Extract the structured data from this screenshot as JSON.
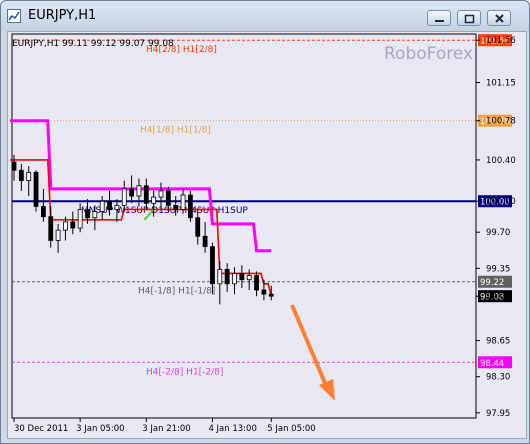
{
  "window": {
    "title": "EURJPY,H1"
  },
  "chart_header": {
    "symbol_info": "EURJPY,H1  99.11 99.12 99.07 99.08",
    "watermark": "RoboForex"
  },
  "colors": {
    "background": "#e8e8f4",
    "candles": "#000000",
    "red_line": "#ff0000",
    "magenta_line": "#ff00ff",
    "blue_line": "#000080",
    "arrow": "#ff8030"
  },
  "levels": [
    {
      "value": 101.56,
      "label": "H4[2/8] H1[2/8]",
      "line_color": "#ff4000",
      "tag_bg": "#ff4000",
      "tag_text": "101.56",
      "style": "dashed"
    },
    {
      "value": 100.78,
      "label": "H4[1/8] H1[1/8]",
      "line_color": "#e8a040",
      "tag_bg": "#f0a040",
      "tag_text": "100.78",
      "style": "dotted"
    },
    {
      "value": 100.0,
      "label": "MNSUP W1SUP D1SUP H4SUP H1SUP",
      "line_color": "#000080",
      "tag_bg": "#000080",
      "tag_text": "100.00",
      "style": "solid"
    },
    {
      "value": 99.22,
      "label": "H4[-1/8] H1[-1/8]",
      "line_color": "#606060",
      "tag_bg": "#606060",
      "tag_text": "99.22",
      "style": "dashed"
    },
    {
      "value": 98.44,
      "label": "H4[-2/8] H1[-2/8]",
      "line_color": "#e040e0",
      "tag_bg": "#ff00ff",
      "tag_text": "98.44",
      "style": "dashed"
    }
  ],
  "current_price": {
    "value": 99.08,
    "text": "99.08"
  },
  "chart_data": {
    "type": "candlestick",
    "title": "EURJPY,H1",
    "y_ticks": [
      "101.56",
      "101.15",
      "100.78",
      "100.40",
      "100.00",
      "99.70",
      "99.35",
      "99.08",
      "98.65",
      "98.30",
      "97.95"
    ],
    "x_ticks": [
      "30 Dec 2011",
      "3 Jan 05:00",
      "3 Jan 21:00",
      "4 Jan 13:00",
      "5 Jan 05:00"
    ],
    "ylim": [
      97.9,
      101.62
    ],
    "candles": [
      {
        "o": 100.38,
        "h": 100.45,
        "l": 100.2,
        "c": 100.3
      },
      {
        "o": 100.3,
        "h": 100.36,
        "l": 100.1,
        "c": 100.2
      },
      {
        "o": 100.2,
        "h": 100.34,
        "l": 100.05,
        "c": 100.28
      },
      {
        "o": 100.28,
        "h": 100.3,
        "l": 99.9,
        "c": 99.95
      },
      {
        "o": 99.95,
        "h": 100.12,
        "l": 99.8,
        "c": 99.85
      },
      {
        "o": 99.85,
        "h": 99.95,
        "l": 99.55,
        "c": 99.62
      },
      {
        "o": 99.62,
        "h": 99.78,
        "l": 99.5,
        "c": 99.72
      },
      {
        "o": 99.72,
        "h": 99.85,
        "l": 99.62,
        "c": 99.8
      },
      {
        "o": 99.8,
        "h": 99.9,
        "l": 99.68,
        "c": 99.74
      },
      {
        "o": 99.74,
        "h": 99.98,
        "l": 99.7,
        "c": 99.92
      },
      {
        "o": 99.92,
        "h": 100.02,
        "l": 99.78,
        "c": 99.84
      },
      {
        "o": 99.84,
        "h": 99.96,
        "l": 99.72,
        "c": 99.9
      },
      {
        "o": 99.9,
        "h": 100.05,
        "l": 99.82,
        "c": 100.0
      },
      {
        "o": 100.0,
        "h": 100.1,
        "l": 99.86,
        "c": 99.92
      },
      {
        "o": 99.92,
        "h": 100.02,
        "l": 99.8,
        "c": 99.96
      },
      {
        "o": 99.96,
        "h": 100.2,
        "l": 99.9,
        "c": 100.12
      },
      {
        "o": 100.12,
        "h": 100.25,
        "l": 99.98,
        "c": 100.05
      },
      {
        "o": 100.05,
        "h": 100.22,
        "l": 99.95,
        "c": 100.15
      },
      {
        "o": 100.15,
        "h": 100.22,
        "l": 99.92,
        "c": 99.98
      },
      {
        "o": 99.98,
        "h": 100.1,
        "l": 99.85,
        "c": 100.04
      },
      {
        "o": 100.04,
        "h": 100.18,
        "l": 99.92,
        "c": 100.1
      },
      {
        "o": 100.1,
        "h": 100.14,
        "l": 99.9,
        "c": 99.96
      },
      {
        "o": 99.96,
        "h": 100.05,
        "l": 99.86,
        "c": 99.92
      },
      {
        "o": 99.92,
        "h": 100.12,
        "l": 99.88,
        "c": 100.06
      },
      {
        "o": 100.06,
        "h": 100.1,
        "l": 99.8,
        "c": 99.84
      },
      {
        "o": 99.84,
        "h": 99.92,
        "l": 99.58,
        "c": 99.66
      },
      {
        "o": 99.66,
        "h": 99.8,
        "l": 99.5,
        "c": 99.56
      },
      {
        "o": 99.56,
        "h": 99.6,
        "l": 99.1,
        "c": 99.2
      },
      {
        "o": 99.2,
        "h": 99.42,
        "l": 99.0,
        "c": 99.34
      },
      {
        "o": 99.34,
        "h": 99.4,
        "l": 99.12,
        "c": 99.2
      },
      {
        "o": 99.2,
        "h": 99.36,
        "l": 99.1,
        "c": 99.3
      },
      {
        "o": 99.3,
        "h": 99.38,
        "l": 99.16,
        "c": 99.24
      },
      {
        "o": 99.24,
        "h": 99.34,
        "l": 99.14,
        "c": 99.28
      },
      {
        "o": 99.28,
        "h": 99.32,
        "l": 99.08,
        "c": 99.14
      },
      {
        "o": 99.14,
        "h": 99.24,
        "l": 99.04,
        "c": 99.1
      },
      {
        "o": 99.1,
        "h": 99.18,
        "l": 99.04,
        "c": 99.08
      }
    ],
    "red_line": [
      100.4,
      100.4,
      100.4,
      100.4,
      100.4,
      99.82,
      99.82,
      99.82,
      99.82,
      99.82,
      99.82,
      99.82,
      99.82,
      99.82,
      99.82,
      99.92,
      99.92,
      99.92,
      99.92,
      99.92,
      99.92,
      99.92,
      99.92,
      99.92,
      99.92,
      99.92,
      99.92,
      99.92,
      99.3,
      99.3,
      99.3,
      99.3,
      99.3,
      99.3,
      99.2,
      99.08
    ],
    "magenta_line": [
      100.78,
      100.78,
      100.78,
      100.78,
      100.78,
      100.12,
      100.12,
      100.12,
      100.12,
      100.12,
      100.12,
      100.12,
      100.12,
      100.12,
      100.12,
      100.12,
      100.12,
      100.12,
      100.12,
      100.12,
      100.12,
      100.12,
      100.12,
      100.12,
      100.12,
      100.12,
      100.12,
      99.78,
      99.78,
      99.78,
      99.78,
      99.78,
      99.78,
      99.52,
      99.52,
      99.52
    ]
  }
}
